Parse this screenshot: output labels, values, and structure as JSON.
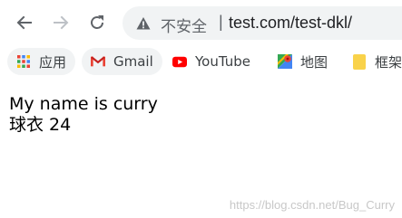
{
  "toolbar": {
    "back_icon": "arrow-left-icon",
    "forward_icon": "arrow-right-icon",
    "reload_icon": "reload-icon",
    "security_label": "不安全",
    "separator": "|",
    "url": "test.com/test-dkl/"
  },
  "bookmarks": [
    {
      "label": "应用",
      "icon": "apps-grid-icon"
    },
    {
      "label": "Gmail",
      "icon": "gmail-icon"
    },
    {
      "label": "YouTube",
      "icon": "youtube-icon"
    },
    {
      "label": "地图",
      "icon": "maps-icon"
    },
    {
      "label": "框架",
      "icon": "folder-icon"
    }
  ],
  "page": {
    "line1": "My name is curry",
    "line2": "球衣 24"
  },
  "watermark": "https://blog.csdn.net/Bug_Curry",
  "colors": {
    "omnibox_bg": "#f1f3f4",
    "icon_gray": "#5f6368",
    "gmail_red": "#ea4335",
    "youtube_red": "#ff0000",
    "folder_yellow": "#f9d24a"
  }
}
